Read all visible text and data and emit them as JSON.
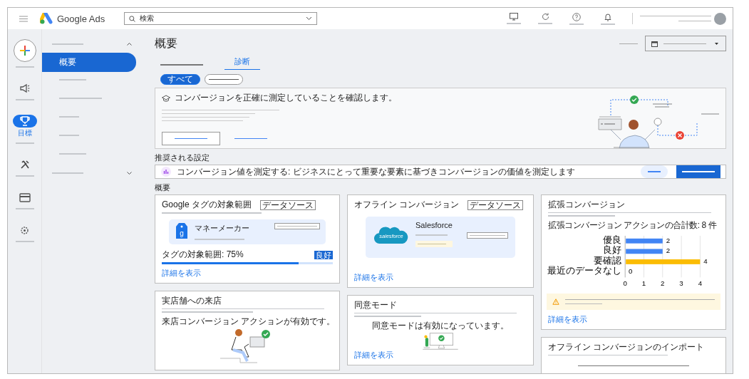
{
  "topbar": {
    "product": "Google Ads",
    "search": {
      "value": "検索"
    }
  },
  "rail": [
    {
      "kind": "create",
      "selected": false
    },
    {
      "kind": "campaigns",
      "selected": false
    },
    {
      "kind": "goals",
      "label": "目標",
      "selected": true
    },
    {
      "kind": "tools",
      "selected": false
    },
    {
      "kind": "billing",
      "selected": false
    },
    {
      "kind": "settings",
      "selected": false
    }
  ],
  "nav": {
    "items": [
      {
        "label": "概要",
        "selected": true
      }
    ]
  },
  "page_title": "概要",
  "tabs": [
    {
      "label": "診断",
      "selected": true
    }
  ],
  "filters": [
    {
      "label": "すべて",
      "selected": true
    }
  ],
  "banner": {
    "title": "コンバージョンを正確に測定していることを確認します。"
  },
  "recommended": {
    "heading": "推奨される設定",
    "text": "コンバージョン値を測定する: ビジネスにとって重要な要素に基づきコンバージョンの価値を測定します"
  },
  "overview": {
    "heading": "概要",
    "columns": [
      [
        {
          "kind": "tag",
          "title": "Google タグの対象範囲",
          "badge": "データソース",
          "source": "マネーメーカー",
          "tag_icon_letter": "g",
          "coverage": "タグの対象範囲: 75%",
          "level": 0.8,
          "status": "良好",
          "link": "詳細を表示"
        },
        {
          "kind": "store",
          "title": "実店舗への来店",
          "message": "来店コンバージョン アクションが有効です。"
        }
      ],
      [
        {
          "kind": "offline",
          "title": "オフライン コンバージョン",
          "badge": "データソース",
          "source": "Salesforce",
          "logo_text": "salesforce",
          "link": "詳細を表示"
        },
        {
          "kind": "consent",
          "title": "同意モード",
          "message": "同意モードは有効になっています。",
          "link": "詳細を表示"
        }
      ],
      [
        {
          "kind": "enhanced",
          "title": "拡張コンバージョン",
          "summary": "拡張コンバージョン アクションの合計数: 8 件",
          "chart_data": {
            "type": "bar",
            "orientation": "horizontal",
            "categories": [
              "優良",
              "良好",
              "要確認",
              "最近のデータなし"
            ],
            "series": [
              {
                "color": "#4285f4",
                "values": [
                  2,
                  2,
                  null,
                  0
                ]
              },
              {
                "color": "#fbbc04",
                "values": [
                  null,
                  null,
                  4,
                  null
                ]
              }
            ],
            "grid": true,
            "xlim": [
              0,
              4
            ],
            "xticks": [
              0,
              1,
              2,
              3,
              4
            ],
            "data_labels": true
          },
          "link": "詳細を表示"
        },
        {
          "kind": "import",
          "title": "オフライン コンバージョンのインポート"
        }
      ]
    ]
  }
}
